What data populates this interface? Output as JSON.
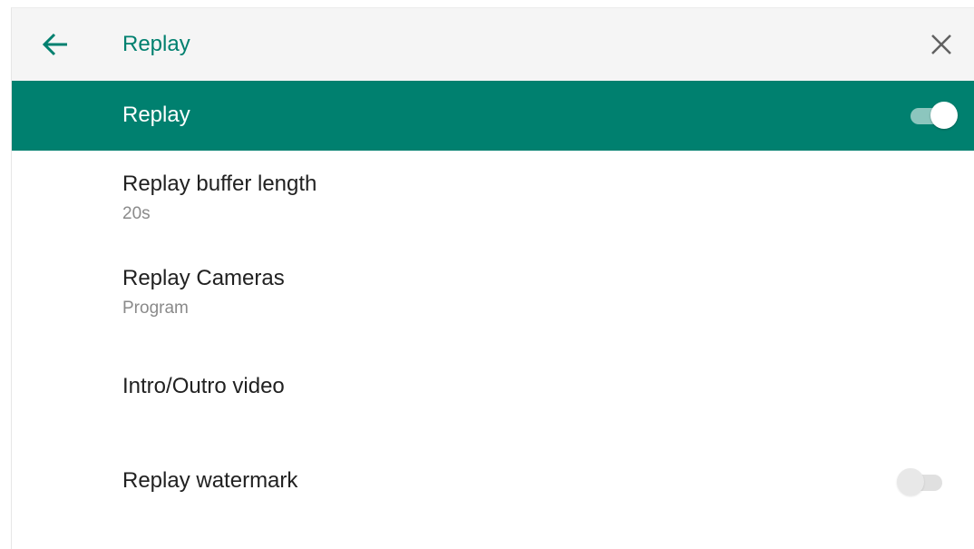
{
  "header": {
    "back_icon": "arrow-left-icon",
    "title": "Replay",
    "close_icon": "close-icon",
    "accent_color": "#00806f"
  },
  "master": {
    "label": "Replay",
    "enabled": true,
    "background": "#00806f"
  },
  "items": [
    {
      "title": "Replay buffer length",
      "subtitle": "20s"
    },
    {
      "title": "Replay Cameras",
      "subtitle": "Program"
    },
    {
      "title": "Intro/Outro video"
    },
    {
      "title": "Replay watermark",
      "toggle_enabled": false
    }
  ]
}
